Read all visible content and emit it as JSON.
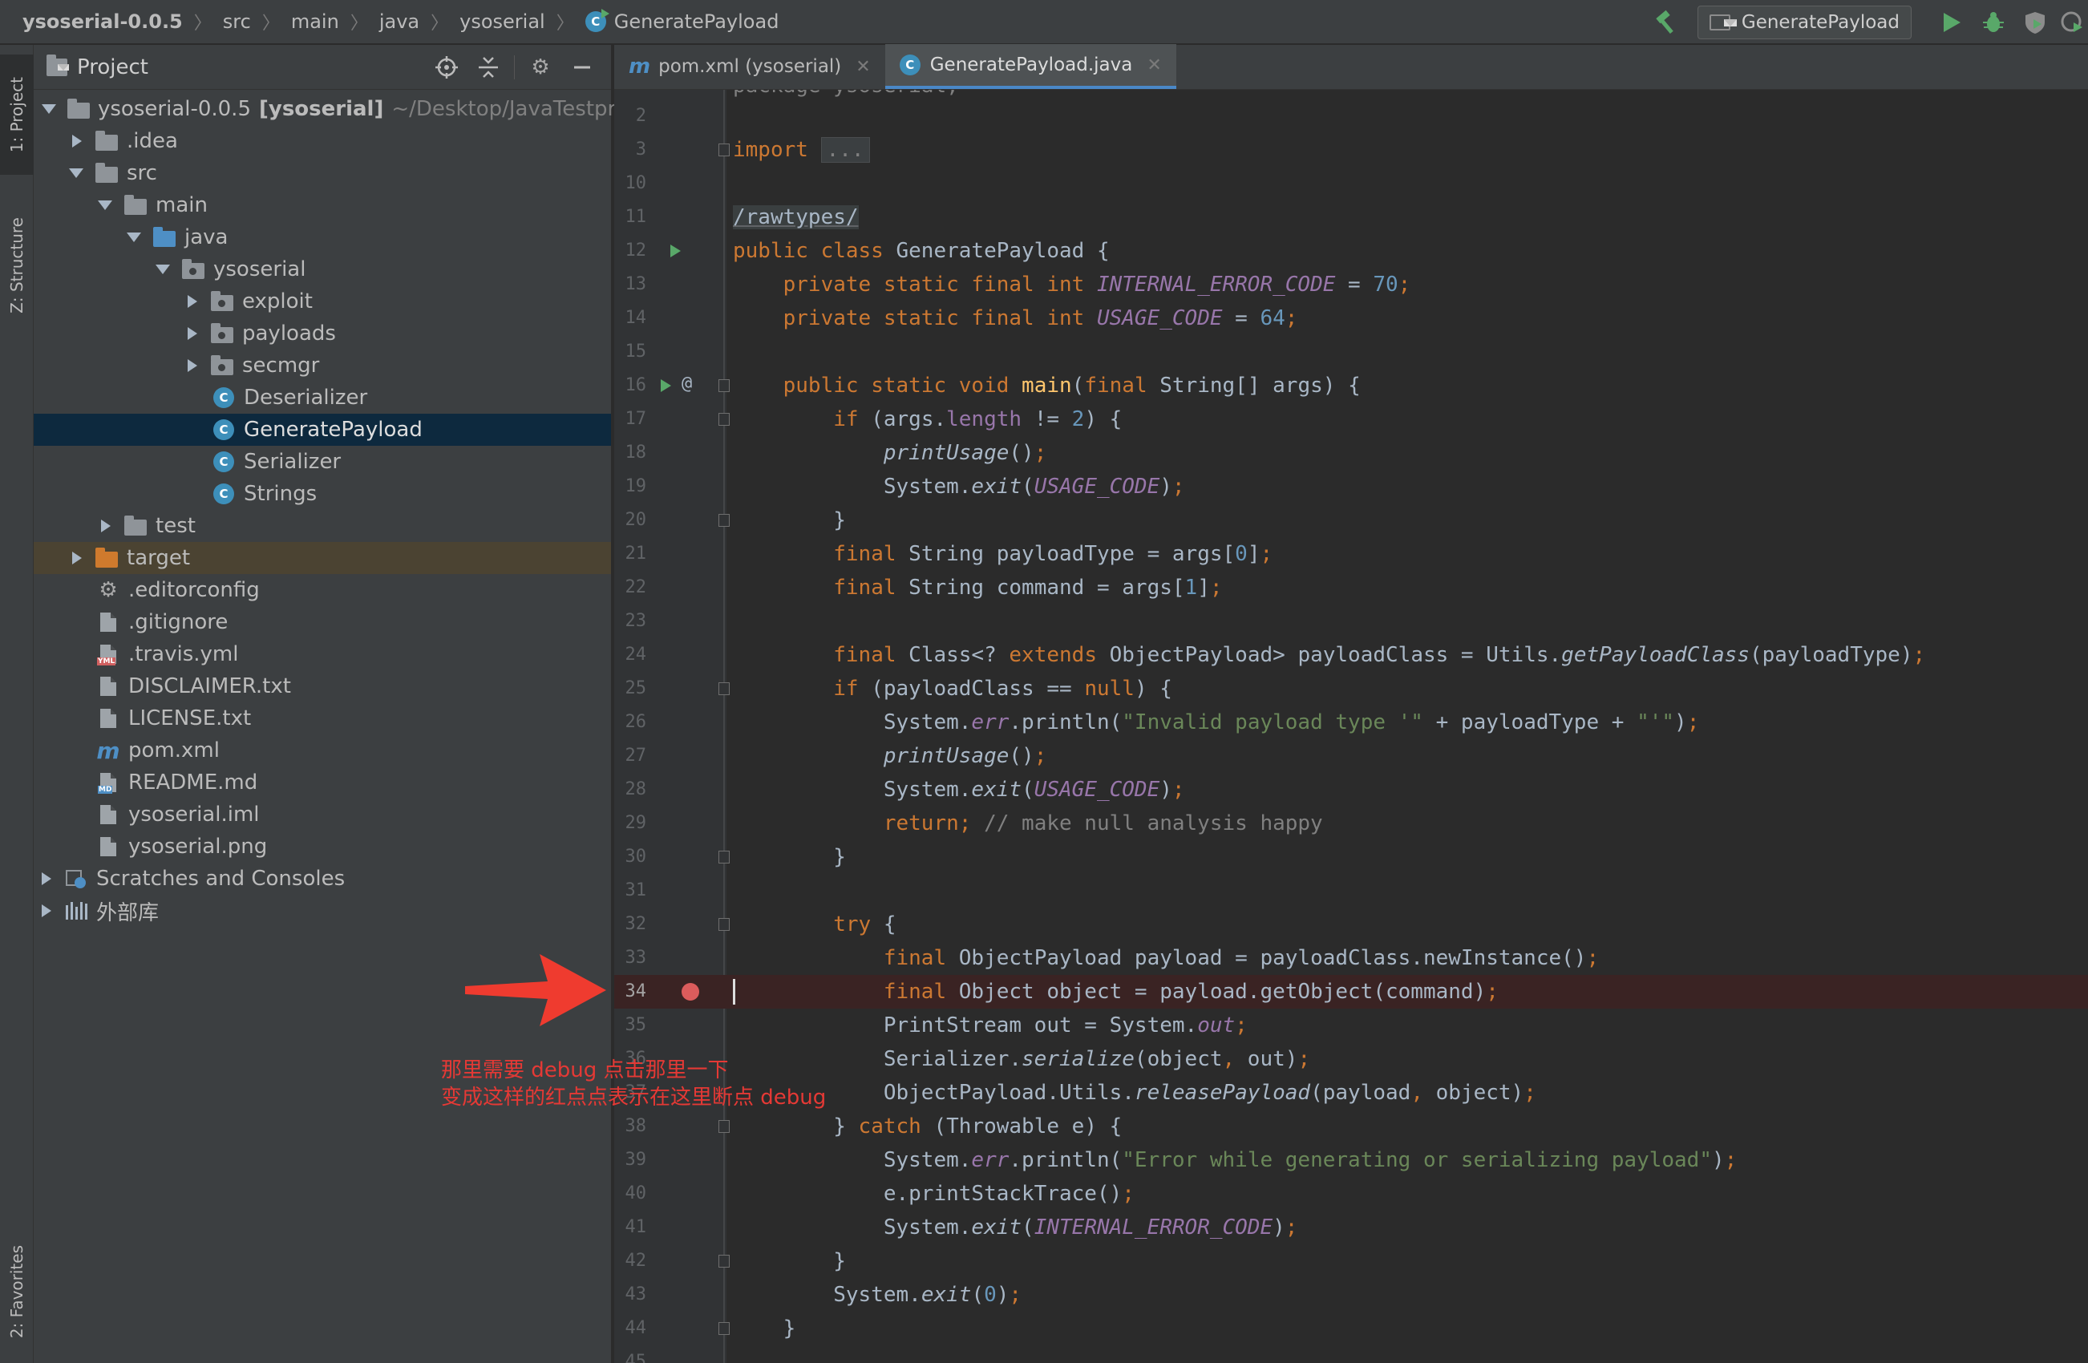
{
  "breadcrumbs": [
    "ysoserial-0.0.5",
    "src",
    "main",
    "java",
    "ysoserial",
    "GeneratePayload"
  ],
  "run_config": "GeneratePayload",
  "left_tabs": [
    "1: Project",
    "Z: Structure",
    "2: Favorites"
  ],
  "project_panel": {
    "title": "Project",
    "tree": [
      {
        "label": "ysoserial-0.0.5",
        "bold_suffix": "[ysoserial]",
        "path": "~/Desktop/JavaTestpro"
      },
      {
        "label": ".idea"
      },
      {
        "label": "src"
      },
      {
        "label": "main"
      },
      {
        "label": "java"
      },
      {
        "label": "ysoserial"
      },
      {
        "label": "exploit"
      },
      {
        "label": "payloads"
      },
      {
        "label": "secmgr"
      },
      {
        "label": "Deserializer"
      },
      {
        "label": "GeneratePayload"
      },
      {
        "label": "Serializer"
      },
      {
        "label": "Strings"
      },
      {
        "label": "test"
      },
      {
        "label": "target"
      },
      {
        "label": ".editorconfig"
      },
      {
        "label": ".gitignore"
      },
      {
        "label": ".travis.yml"
      },
      {
        "label": "DISCLAIMER.txt"
      },
      {
        "label": "LICENSE.txt"
      },
      {
        "label": "pom.xml"
      },
      {
        "label": "README.md"
      },
      {
        "label": "ysoserial.iml"
      },
      {
        "label": "ysoserial.png"
      },
      {
        "label": "Scratches and Consoles"
      },
      {
        "label": "外部库"
      }
    ]
  },
  "tabs": [
    {
      "label": "pom.xml (ysoserial)"
    },
    {
      "label": "GeneratePayload.java"
    }
  ],
  "editor": {
    "line_numbers": [
      "2",
      "3",
      "10",
      "11",
      "12",
      "13",
      "14",
      "15",
      "16",
      "17",
      "18",
      "19",
      "20",
      "21",
      "22",
      "23",
      "24",
      "25",
      "26",
      "27",
      "28",
      "29",
      "30",
      "31",
      "32",
      "33",
      "34",
      "35",
      "36",
      "37",
      "38",
      "39",
      "40",
      "41",
      "42",
      "43",
      "44",
      "45"
    ],
    "code": {
      "l3_kw": "import",
      "l3_fold": "...",
      "l11": "/rawtypes/",
      "l12_kw": "public class",
      "l12_rest": " GeneratePayload {",
      "l13_kw": "private static final int",
      "l13_const": "INTERNAL_ERROR_CODE",
      "l13_eq": " = ",
      "l13_num": "70",
      "l13_end": ";",
      "l14_kw": "private static final int",
      "l14_const": "USAGE_CODE",
      "l14_eq": " = ",
      "l14_num": "64",
      "l14_end": ";",
      "l16_kw": "public static void",
      "l16_m": "main",
      "l16_a": "(",
      "l16_kw2": "final",
      "l16_b": " String[] args) {",
      "l17_kw": "if",
      "l17_a": " (args.",
      "l17_f": "length",
      "l17_b": " != ",
      "l17_num": "2",
      "l17_c": ") {",
      "l18_m": "printUsage",
      "l18_a": "()",
      "l18_end": ";",
      "l19_a": "System.",
      "l19_m": "exit",
      "l19_b": "(",
      "l19_c": "USAGE_CODE",
      "l19_d": ")",
      "l19_end": ";",
      "l20": "}",
      "l21_kw": "final",
      "l21_a": " String payloadType = args[",
      "l21_num": "0",
      "l21_b": "]",
      "l21_end": ";",
      "l22_kw": "final",
      "l22_a": " String command = args[",
      "l22_num": "1",
      "l22_b": "]",
      "l22_end": ";",
      "l24_kw": "final",
      "l24_a": " Class<? ",
      "l24_kw2": "extends",
      "l24_b": " ObjectPayload> payloadClass = Utils.",
      "l24_m": "getPayloadClass",
      "l24_c": "(payloadType)",
      "l24_end": ";",
      "l25_kw": "if",
      "l25_a": " (payloadClass == ",
      "l25_kw2": "null",
      "l25_b": ") {",
      "l26_a": "System.",
      "l26_f": "err",
      "l26_b": ".println(",
      "l26_s1": "\"Invalid payload type '\"",
      "l26_c": " + payloadType + ",
      "l26_s2": "\"'\"",
      "l26_d": ")",
      "l26_end": ";",
      "l27_m": "printUsage",
      "l27_a": "()",
      "l27_end": ";",
      "l28_a": "System.",
      "l28_m": "exit",
      "l28_b": "(",
      "l28_c": "USAGE_CODE",
      "l28_d": ")",
      "l28_end": ";",
      "l29_kw": "return;",
      "l29_cmt": " // make null analysis happy",
      "l30": "}",
      "l32_kw": "try",
      "l32_a": " {",
      "l33_kw": "final",
      "l33_a": " ObjectPayload payload = payloadClass.newInstance()",
      "l33_end": ";",
      "l34_kw": "final",
      "l34_a": " Object object = payload.getObject(command)",
      "l34_end": ";",
      "l35_a": "PrintStream out = System.",
      "l35_f": "out",
      "l35_end": ";",
      "l36_a": "Serializer.",
      "l36_m": "serialize",
      "l36_b": "(object",
      "l36_c": ",",
      "l36_d": " out)",
      "l36_end": ";",
      "l37_a": "ObjectPayload.Utils.",
      "l37_m": "releasePayload",
      "l37_b": "(payload",
      "l37_c": ",",
      "l37_d": " object)",
      "l37_end": ";",
      "l38_a": "} ",
      "l38_kw": "catch",
      "l38_b": " (Throwable e) {",
      "l39_a": "System.",
      "l39_f": "err",
      "l39_b": ".println(",
      "l39_s": "\"Error while generating or serializing payload\"",
      "l39_c": ")",
      "l39_end": ";",
      "l40_a": "e.printStackTrace()",
      "l40_end": ";",
      "l41_a": "System.",
      "l41_m": "exit",
      "l41_b": "(",
      "l41_c": "INTERNAL_ERROR_CODE",
      "l41_d": ")",
      "l41_end": ";",
      "l42": "}",
      "l43_a": "System.",
      "l43_m": "exit",
      "l43_b": "(",
      "l43_num": "0",
      "l43_c": ")",
      "l43_end": ";",
      "l44": "}"
    }
  },
  "annotation": {
    "line1": "那里需要 debug 点击那里一下",
    "line2": "变成这样的红点点表示在这里断点 debug",
    "color": "#e53935"
  },
  "colors": {
    "keyword": "#cc7832",
    "number": "#6897bb",
    "string": "#6a8759",
    "constant": "#9876aa",
    "method": "#ffc66d",
    "comment": "#808080",
    "breakpoint": "#db5c5c",
    "selection": "#0d293e"
  }
}
